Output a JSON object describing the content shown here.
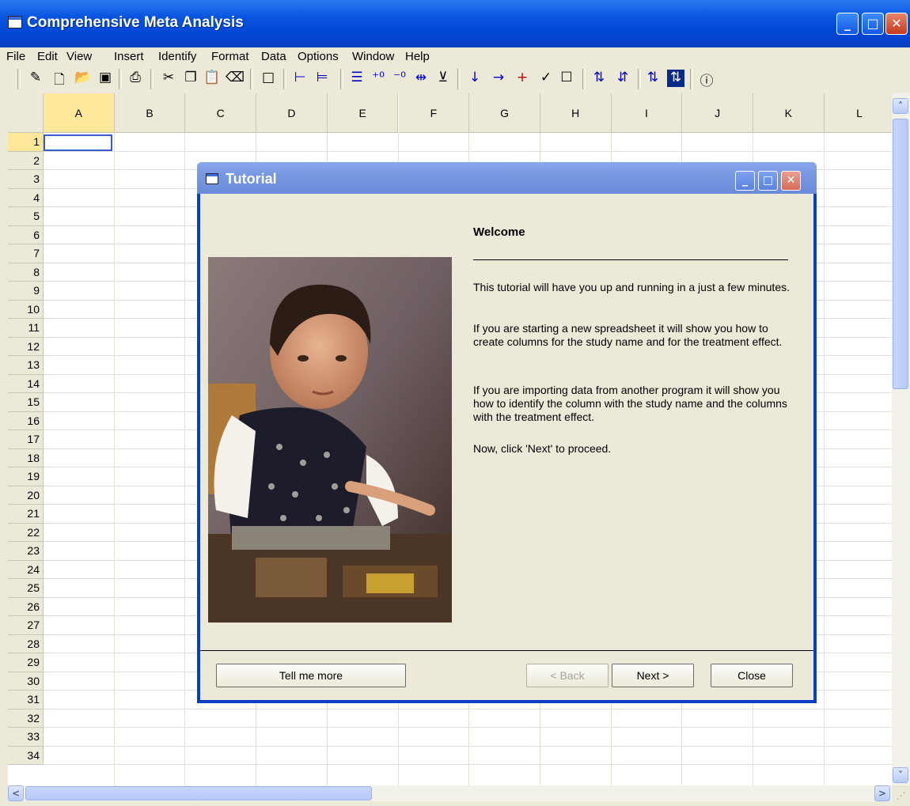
{
  "app": {
    "title": "Comprehensive Meta Analysis"
  },
  "window_controls": {
    "minimize": "_",
    "maximize": "□",
    "close": "✕"
  },
  "menu": [
    "File",
    "Edit",
    "View",
    "Insert",
    "Identify",
    "Format",
    "Data",
    "Options",
    "Window",
    "Help"
  ],
  "toolbar": {
    "icons": [
      "pointer-icon",
      "new-icon",
      "open-icon",
      "save-icon",
      "print-icon",
      "cut-icon",
      "copy-icon",
      "paste-icon",
      "eraser-icon",
      "blank-page-icon",
      "indent-left-icon",
      "indent-right-icon",
      "list-icon",
      "increase-decimal-icon",
      "decrease-decimal-icon",
      "column-width-icon",
      "dropdown-icon",
      "move-down-icon",
      "move-right-icon",
      "insert-plus-icon",
      "check-icon",
      "checkbox-icon",
      "sort-ascending-icon",
      "sort-descending-icon",
      "swap-icon",
      "swap-dark-icon",
      "info-icon"
    ]
  },
  "grid": {
    "columns": [
      "A",
      "B",
      "C",
      "D",
      "E",
      "F",
      "G",
      "H",
      "I",
      "J",
      "K",
      "L"
    ],
    "rows": [
      "1",
      "2",
      "3",
      "4",
      "5",
      "6",
      "7",
      "8",
      "9",
      "10",
      "11",
      "12",
      "13",
      "14",
      "15",
      "16",
      "17",
      "18",
      "19",
      "20",
      "21",
      "22",
      "23",
      "24",
      "25",
      "26",
      "27",
      "28",
      "29",
      "30",
      "31",
      "32",
      "33",
      "34"
    ],
    "selected_column": "A",
    "selected_row": "1"
  },
  "dialog": {
    "title": "Tutorial",
    "heading": "Welcome",
    "paragraphs": [
      "This tutorial will have you up and running in a just a few minutes.",
      "If you are starting a new spreadsheet it will show you how to create columns for the study name and for the treatment effect.",
      "If you are importing data from another program it will show you how to identify the column with the study name and the columns with the treatment effect.",
      "Now, click 'Next' to proceed."
    ],
    "buttons": {
      "tell_me_more": "Tell me more",
      "back": "< Back",
      "next": "Next >",
      "close": "Close"
    }
  },
  "colors": {
    "title_blue": "#0a55e0",
    "dialog_title": "#7797e0",
    "selection": "#fde79b",
    "face": "#ece9d8"
  }
}
